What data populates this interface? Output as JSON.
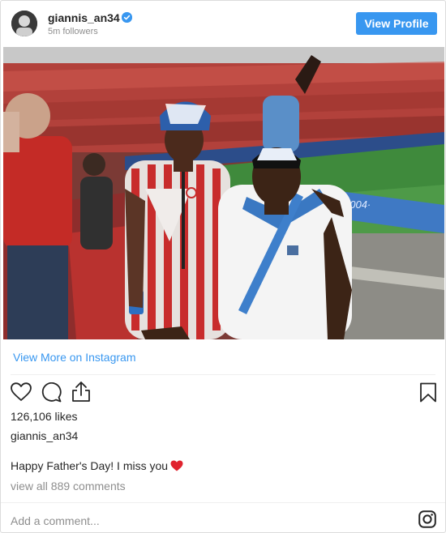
{
  "header": {
    "username": "giannis_an34",
    "followers": "5m followers",
    "view_profile_label": "View Profile"
  },
  "post": {
    "view_more_label": "View More on Instagram",
    "likes": "126,106 likes",
    "caption_username": "giannis_an34",
    "caption_text": "Happy Father's Day! I miss you",
    "comments_link": "view all 889 comments",
    "add_comment_placeholder": "Add a comment..."
  },
  "colors": {
    "accent": "#3897f0",
    "muted_text": "#8e8e8e",
    "emoji_heart": "#e0232e"
  },
  "icons": [
    "verified-badge-icon",
    "like-heart-icon",
    "comment-icon",
    "share-icon",
    "bookmark-icon",
    "instagram-logo-icon",
    "red-heart-emoji"
  ]
}
